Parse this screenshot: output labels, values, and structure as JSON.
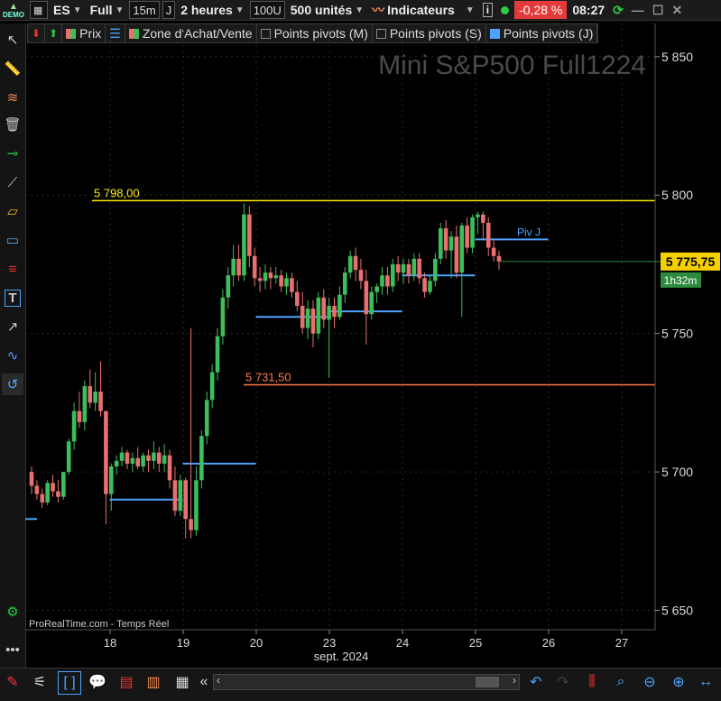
{
  "toolbar": {
    "account": "DEMO",
    "symbol": "ES",
    "mode": "Full",
    "interval": "15m",
    "interval_unit": "J",
    "period": "2 heures",
    "units_short": "100U",
    "units": "500 unités",
    "indicators": "Indicateurs",
    "change": "-0,28 %",
    "time": "08:27"
  },
  "legend": {
    "price": "Prix",
    "zone": "Zone d'Achat/Vente",
    "pivots_m": "Points pivots (M)",
    "pivots_s": "Points pivots (S)",
    "pivots_j": "Points pivots (J)"
  },
  "chart_data": {
    "type": "candlestick",
    "title": "Mini S&P500 Full1224",
    "source": "ProRealTime.com - Temps Réel",
    "month_label": "sept. 2024",
    "x_ticks": [
      "18",
      "19",
      "20",
      "23",
      "24",
      "25",
      "26",
      "27"
    ],
    "y_ticks": [
      "5 850",
      "5 800",
      "5 750",
      "5 700",
      "5 650"
    ],
    "ylim": [
      5643,
      5862
    ],
    "last_price": "5 775,75",
    "countdown": "1h32m",
    "level_high": {
      "label": "5 798,00",
      "value": 5798.0,
      "color": "#ffea00"
    },
    "level_low": {
      "label": "5 731,50",
      "value": 5731.5,
      "color": "#ff7a4a"
    },
    "pivot_label": "Piv J",
    "pivots": [
      {
        "from": 0.0,
        "to": 0.4,
        "value": 5683
      },
      {
        "from": 1.0,
        "to": 2.0,
        "value": 5690
      },
      {
        "from": 2.0,
        "to": 3.0,
        "value": 5703
      },
      {
        "from": 3.0,
        "to": 4.0,
        "value": 5756
      },
      {
        "from": 4.0,
        "to": 5.0,
        "value": 5758
      },
      {
        "from": 5.0,
        "to": 6.0,
        "value": 5771
      },
      {
        "from": 6.0,
        "to": 7.0,
        "value": 5784
      }
    ],
    "candles": [
      [
        5700,
        5702,
        5692,
        5695
      ],
      [
        5695,
        5697,
        5690,
        5692
      ],
      [
        5692,
        5694,
        5687,
        5689
      ],
      [
        5689,
        5697,
        5688,
        5696
      ],
      [
        5696,
        5699,
        5691,
        5693
      ],
      [
        5693,
        5697,
        5689,
        5691
      ],
      [
        5691,
        5700,
        5690,
        5700
      ],
      [
        5700,
        5712,
        5699,
        5711
      ],
      [
        5711,
        5725,
        5708,
        5722
      ],
      [
        5722,
        5729,
        5716,
        5718
      ],
      [
        5718,
        5733,
        5715,
        5731
      ],
      [
        5731,
        5737,
        5723,
        5725
      ],
      [
        5725,
        5736,
        5722,
        5729
      ],
      [
        5729,
        5740,
        5720,
        5722
      ],
      [
        5722,
        5722,
        5681,
        5692
      ],
      [
        5692,
        5703,
        5686,
        5702
      ],
      [
        5702,
        5706,
        5699,
        5704
      ],
      [
        5704,
        5709,
        5702,
        5707
      ],
      [
        5707,
        5708,
        5701,
        5703
      ],
      [
        5703,
        5707,
        5700,
        5705
      ],
      [
        5705,
        5709,
        5701,
        5702
      ],
      [
        5702,
        5707,
        5700,
        5706
      ],
      [
        5706,
        5708,
        5700,
        5704
      ],
      [
        5704,
        5711,
        5701,
        5707
      ],
      [
        5707,
        5709,
        5700,
        5703
      ],
      [
        5703,
        5710,
        5700,
        5706
      ],
      [
        5706,
        5708,
        5694,
        5697
      ],
      [
        5697,
        5702,
        5684,
        5686
      ],
      [
        5686,
        5699,
        5684,
        5697
      ],
      [
        5697,
        5698,
        5676,
        5683
      ],
      [
        5683,
        5752,
        5676,
        5679
      ],
      [
        5679,
        5702,
        5677,
        5697
      ],
      [
        5697,
        5715,
        5694,
        5713
      ],
      [
        5713,
        5729,
        5710,
        5726
      ],
      [
        5726,
        5739,
        5723,
        5736
      ],
      [
        5736,
        5752,
        5733,
        5749
      ],
      [
        5749,
        5766,
        5746,
        5763
      ],
      [
        5763,
        5774,
        5759,
        5771
      ],
      [
        5771,
        5782,
        5767,
        5777
      ],
      [
        5777,
        5782,
        5769,
        5771
      ],
      [
        5771,
        5797,
        5769,
        5793
      ],
      [
        5793,
        5796,
        5774,
        5778
      ],
      [
        5778,
        5781,
        5767,
        5770
      ],
      [
        5770,
        5774,
        5765,
        5769
      ],
      [
        5769,
        5775,
        5766,
        5772
      ],
      [
        5772,
        5774,
        5766,
        5770
      ],
      [
        5770,
        5774,
        5768,
        5771
      ],
      [
        5771,
        5773,
        5765,
        5767
      ],
      [
        5767,
        5772,
        5764,
        5770
      ],
      [
        5770,
        5772,
        5763,
        5765
      ],
      [
        5765,
        5769,
        5758,
        5760
      ],
      [
        5760,
        5765,
        5750,
        5752
      ],
      [
        5752,
        5762,
        5748,
        5759
      ],
      [
        5759,
        5762,
        5745,
        5750
      ],
      [
        5750,
        5765,
        5748,
        5763
      ],
      [
        5763,
        5766,
        5752,
        5755
      ],
      [
        5755,
        5763,
        5734,
        5760
      ],
      [
        5760,
        5763,
        5752,
        5756
      ],
      [
        5756,
        5767,
        5755,
        5764
      ],
      [
        5764,
        5774,
        5761,
        5772
      ],
      [
        5772,
        5780,
        5770,
        5778
      ],
      [
        5778,
        5781,
        5769,
        5773
      ],
      [
        5773,
        5777,
        5766,
        5769
      ],
      [
        5769,
        5773,
        5746,
        5757
      ],
      [
        5757,
        5767,
        5755,
        5765
      ],
      [
        5765,
        5768,
        5761,
        5767
      ],
      [
        5767,
        5774,
        5764,
        5771
      ],
      [
        5771,
        5774,
        5764,
        5767
      ],
      [
        5767,
        5777,
        5765,
        5775
      ],
      [
        5775,
        5778,
        5769,
        5772
      ],
      [
        5772,
        5777,
        5768,
        5775
      ],
      [
        5775,
        5777,
        5768,
        5771
      ],
      [
        5771,
        5779,
        5769,
        5777
      ],
      [
        5777,
        5779,
        5768,
        5770
      ],
      [
        5770,
        5772,
        5763,
        5765
      ],
      [
        5765,
        5771,
        5764,
        5769
      ],
      [
        5769,
        5779,
        5767,
        5777
      ],
      [
        5777,
        5790,
        5775,
        5788
      ],
      [
        5788,
        5791,
        5777,
        5780
      ],
      [
        5780,
        5787,
        5770,
        5785
      ],
      [
        5785,
        5789,
        5770,
        5772
      ],
      [
        5772,
        5790,
        5756,
        5789
      ],
      [
        5789,
        5792,
        5779,
        5781
      ],
      [
        5781,
        5793,
        5779,
        5792
      ],
      [
        5792,
        5794,
        5786,
        5793
      ],
      [
        5793,
        5794,
        5784,
        5790
      ],
      [
        5790,
        5792,
        5778,
        5781
      ],
      [
        5781,
        5784,
        5776,
        5778
      ],
      [
        5778,
        5780,
        5773,
        5776
      ]
    ]
  }
}
